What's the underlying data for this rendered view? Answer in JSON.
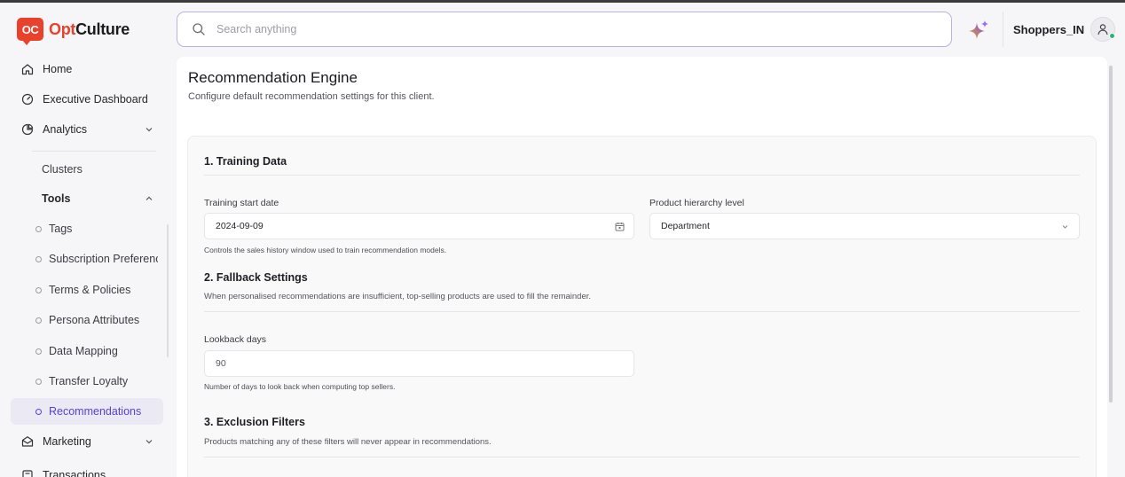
{
  "brand": {
    "logo_mark": "OC",
    "name_part1": "Opt",
    "name_part2": "Culture",
    "color": "#e8412c"
  },
  "search": {
    "placeholder": "Search anything"
  },
  "account": {
    "name": "Shoppers_IN"
  },
  "accent_color": "#5b3fd9",
  "sidebar": {
    "home": "Home",
    "executive_dashboard": "Executive Dashboard",
    "analytics": "Analytics",
    "clusters": "Clusters",
    "tools": "Tools",
    "tools_items": [
      "Tags",
      "Subscription Preferences",
      "Terms & Policies",
      "Persona Attributes",
      "Data Mapping",
      "Transfer Loyalty",
      "Recommendations"
    ],
    "active_item": "Recommendations",
    "marketing": "Marketing",
    "transactions": "Transactions"
  },
  "page": {
    "title": "Recommendation Engine",
    "subtitle": "Configure default recommendation settings for this client."
  },
  "training": {
    "title": "1. Training Data",
    "start_date_label": "Training start date",
    "start_date_value": "2024-09-09",
    "hierarchy_label": "Product hierarchy level",
    "hierarchy_value": "Department",
    "help": "Controls the sales history window used to train recommendation models."
  },
  "fallback": {
    "title": "2. Fallback Settings",
    "desc": "When personalised recommendations are insufficient, top-selling products are used to fill the remainder.",
    "lookback_label": "Lookback days",
    "lookback_value": "90",
    "help": "Number of days to look back when computing top sellers."
  },
  "exclusion": {
    "title": "3. Exclusion Filters",
    "desc": "Products matching any of these filters will never appear in recommendations."
  }
}
